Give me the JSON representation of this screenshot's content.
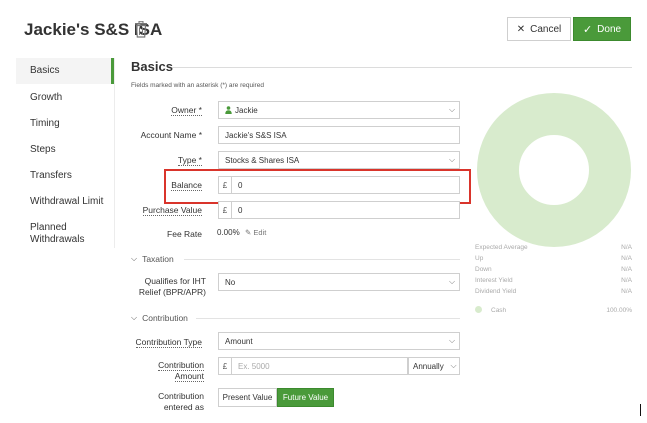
{
  "header": {
    "title": "Jackie's S&S ISA",
    "cancel_label": "Cancel",
    "done_label": "Done"
  },
  "sidebar": {
    "items": [
      {
        "label": "Basics",
        "active": true
      },
      {
        "label": "Growth"
      },
      {
        "label": "Timing"
      },
      {
        "label": "Steps"
      },
      {
        "label": "Transfers"
      },
      {
        "label": "Withdrawal Limit"
      },
      {
        "label": "Planned Withdrawals"
      }
    ]
  },
  "basics": {
    "section_title": "Basics",
    "required_note": "Fields marked with an asterisk (*) are required",
    "owner": {
      "label": "Owner *",
      "value": "Jackie"
    },
    "account_name": {
      "label": "Account Name *",
      "value": "Jackie's S&S ISA"
    },
    "type": {
      "label": "Type *",
      "value": "Stocks & Shares ISA"
    },
    "balance": {
      "label": "Balance",
      "currency": "£",
      "value": "0"
    },
    "purchase_value": {
      "label": "Purchase Value",
      "currency": "£",
      "value": "0"
    },
    "fee_rate": {
      "label": "Fee Rate",
      "value": "0.00%",
      "edit_label": "Edit"
    }
  },
  "taxation": {
    "title": "Taxation",
    "iht_relief": {
      "label_line1": "Qualifies for IHT",
      "label_line2": "Relief (BPR/APR)",
      "value": "No"
    }
  },
  "contribution": {
    "title": "Contribution",
    "type": {
      "label": "Contribution Type",
      "value": "Amount"
    },
    "amount": {
      "label_line1": "Contribution",
      "label_line2": "Amount",
      "currency": "£",
      "placeholder": "Ex. 5000",
      "frequency": "Annually"
    },
    "entered_as": {
      "label_line1": "Contribution",
      "label_line2": "entered as",
      "options": [
        "Present Value",
        "Future Value"
      ],
      "selected": "Future Value"
    }
  },
  "stats": [
    {
      "label": "Expected Average",
      "value": "N/A"
    },
    {
      "label": "Up",
      "value": "N/A"
    },
    {
      "label": "Down",
      "value": "N/A"
    },
    {
      "label": "Interest Yield",
      "value": "N/A"
    },
    {
      "label": "Dividend Yield",
      "value": "N/A"
    }
  ],
  "legend": {
    "label": "Cash",
    "value": "100.00%"
  },
  "colors": {
    "accent": "#4a9a3a",
    "highlight": "#d9342b",
    "donut": "#d8ebcd"
  }
}
